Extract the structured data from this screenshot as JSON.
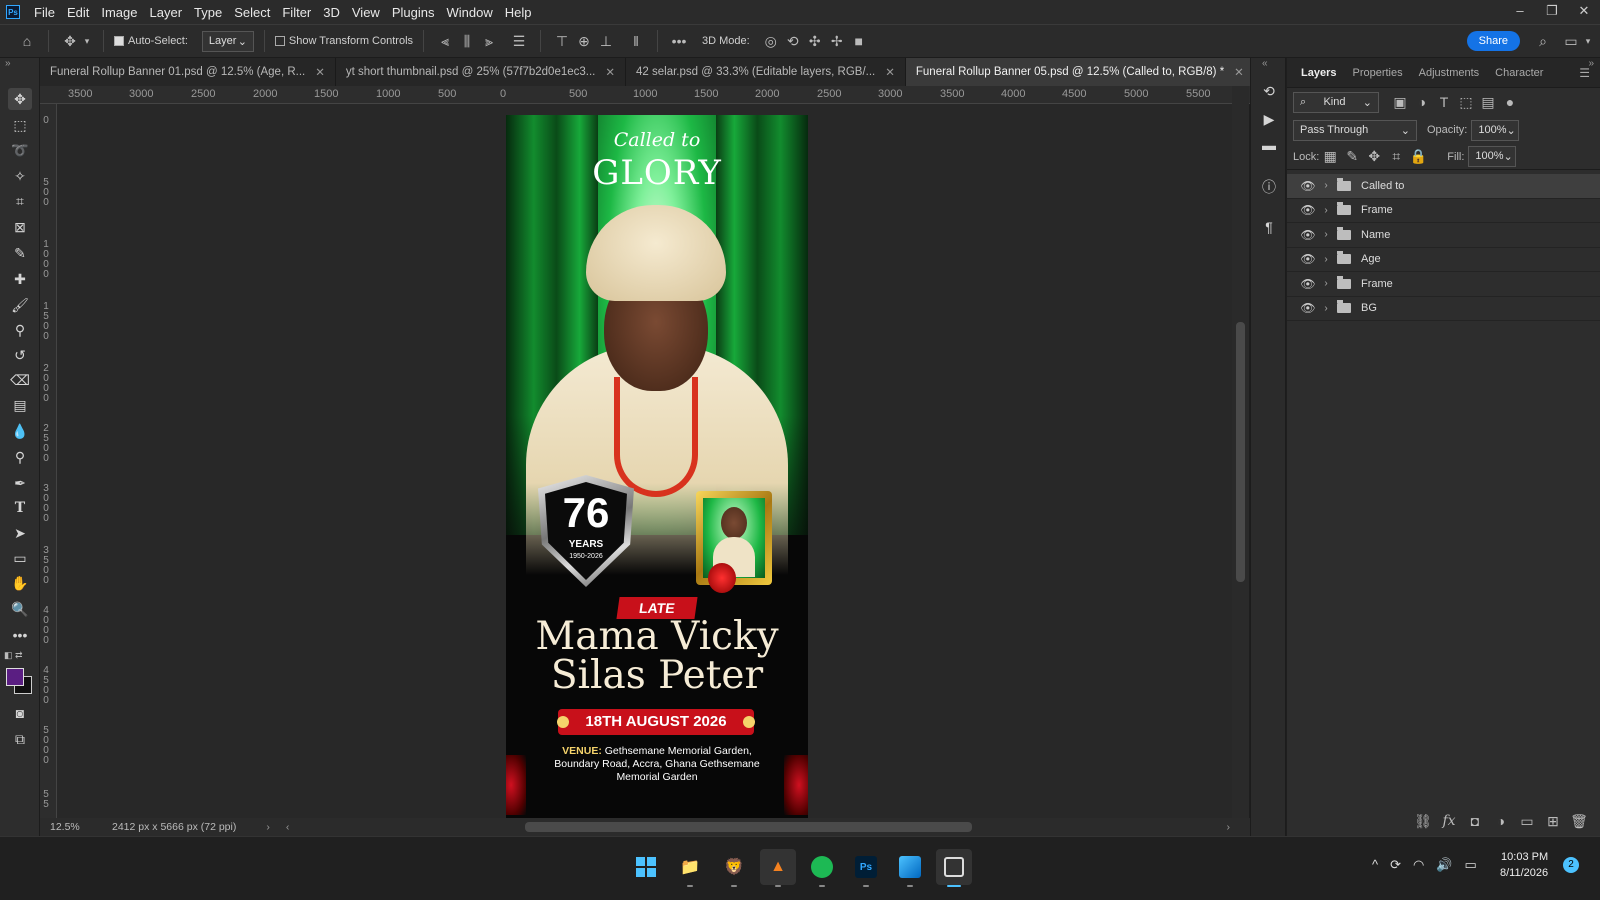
{
  "menubar": {
    "items": [
      "File",
      "Edit",
      "Image",
      "Layer",
      "Type",
      "Select",
      "Filter",
      "3D",
      "View",
      "Plugins",
      "Window",
      "Help"
    ]
  },
  "options": {
    "auto_select": "Auto-Select:",
    "layer_select": "Layer",
    "show_transform": "Show Transform Controls",
    "mode_3d": "3D Mode:",
    "share": "Share"
  },
  "tabs": [
    {
      "label": "Funeral Rollup Banner 01.psd @ 12.5% (Age, R..."
    },
    {
      "label": "yt short thumbnail.psd @ 25% (57f7b2d0e1ec3..."
    },
    {
      "label": "42 selar.psd @ 33.3% (Editable layers, RGB/..."
    },
    {
      "label": "Funeral Rollup Banner 05.psd @ 12.5% (Called to, RGB/8) *"
    }
  ],
  "rulers": {
    "h": [
      "3500",
      "3000",
      "2500",
      "2000",
      "1500",
      "1000",
      "500",
      "0",
      "500",
      "1000",
      "1500",
      "2000",
      "2500",
      "3000",
      "3500",
      "4000",
      "4500",
      "5000",
      "5500"
    ],
    "v": [
      "0",
      "5\n0\n0",
      "1\n0\n0\n0",
      "1\n5\n0\n0",
      "2\n0\n0\n0",
      "2\n5\n0\n0",
      "3\n0\n0\n0",
      "3\n5\n0\n0",
      "4\n0\n0\n0",
      "4\n5\n0\n0",
      "5\n0\n0\n0",
      "5\n5"
    ]
  },
  "status": {
    "zoom": "12.5%",
    "dimensions": "2412 px x 5666 px (72 ppi)"
  },
  "poster": {
    "called_to": "Called to",
    "glory": "GLORY",
    "age": "76",
    "years": "YEARS",
    "year_range": "1950-2026",
    "late": "LATE",
    "name_line1": "Mama Vicky",
    "name_line2": "Silas Peter",
    "date": "18TH AUGUST 2026",
    "venue_label": "VENUE:",
    "venue_text": "Gethsemane Memorial Garden, Boundary Road, Accra, Ghana Gethsemane Memorial Garden"
  },
  "panel": {
    "tabs": [
      "Layers",
      "Properties",
      "Adjustments",
      "Character"
    ],
    "kind": "Kind",
    "blend": "Pass Through",
    "opacity_label": "Opacity:",
    "opacity": "100%",
    "lock_label": "Lock:",
    "fill_label": "Fill:",
    "fill": "100%",
    "layers": [
      {
        "name": "Called to",
        "selected": true
      },
      {
        "name": "Frame"
      },
      {
        "name": "Name"
      },
      {
        "name": "Age"
      },
      {
        "name": "Frame"
      },
      {
        "name": "BG"
      }
    ]
  },
  "taskbar": {
    "time": "10:03 PM",
    "date": "8/11/2026",
    "notif": "2"
  },
  "colors": {
    "accent": "#1473e6",
    "poster_red": "#c8101a",
    "poster_green": "#1db845",
    "gold": "#d4a017"
  }
}
